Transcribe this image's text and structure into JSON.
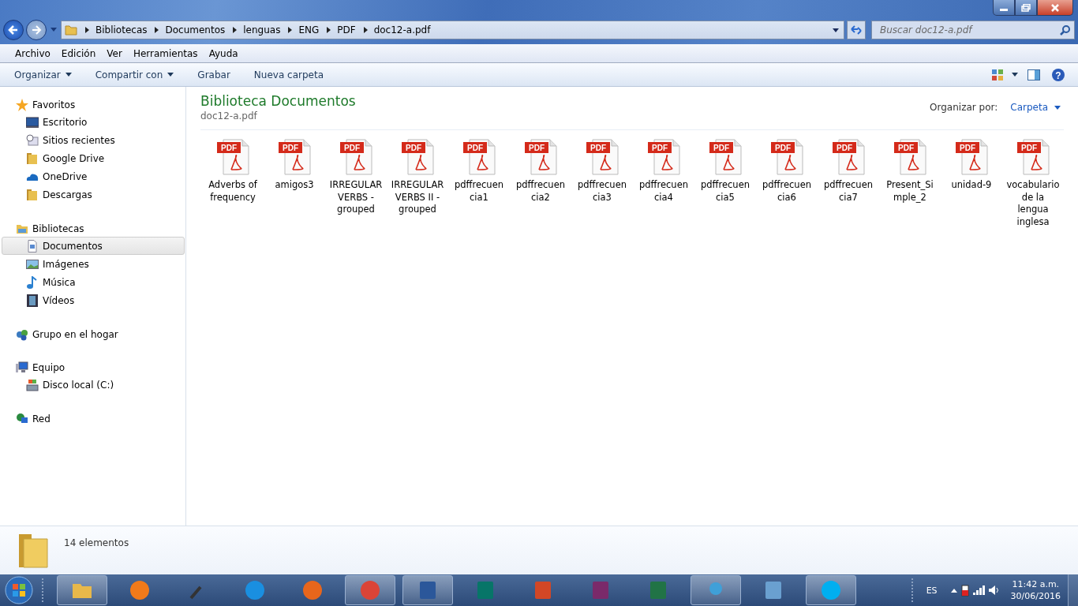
{
  "address": {
    "crumbs": [
      "Bibliotecas",
      "Documentos",
      "lenguas",
      "ENG",
      "PDF",
      "doc12-a.pdf"
    ]
  },
  "search": {
    "placeholder": "Buscar doc12-a.pdf"
  },
  "menu_bar": [
    "Archivo",
    "Edición",
    "Ver",
    "Herramientas",
    "Ayuda"
  ],
  "command_bar": [
    {
      "label": "Organizar",
      "dropdown": true
    },
    {
      "label": "Compartir con",
      "dropdown": true
    },
    {
      "label": "Grabar",
      "dropdown": false
    },
    {
      "label": "Nueva carpeta",
      "dropdown": false
    }
  ],
  "sidebar": {
    "groups": [
      {
        "label": "Favoritos",
        "kind": "star",
        "items": [
          {
            "label": "Escritorio",
            "kind": "desktop",
            "selected": false
          },
          {
            "label": "Sitios recientes",
            "kind": "recent",
            "selected": false
          },
          {
            "label": "Google Drive",
            "kind": "folder",
            "selected": false
          },
          {
            "label": "OneDrive",
            "kind": "cloud",
            "selected": false
          },
          {
            "label": "Descargas",
            "kind": "folder",
            "selected": false
          }
        ]
      },
      {
        "label": "Bibliotecas",
        "kind": "library",
        "items": [
          {
            "label": "Documentos",
            "kind": "document",
            "selected": true
          },
          {
            "label": "Imágenes",
            "kind": "picture",
            "selected": false
          },
          {
            "label": "Música",
            "kind": "music",
            "selected": false
          },
          {
            "label": "Vídeos",
            "kind": "video",
            "selected": false
          }
        ]
      },
      {
        "label": "Grupo en el hogar",
        "kind": "homegroup"
      },
      {
        "label": "Equipo",
        "kind": "computer",
        "items": [
          {
            "label": "Disco local (C:)",
            "kind": "drive",
            "selected": false
          }
        ]
      },
      {
        "label": "Red",
        "kind": "network"
      }
    ]
  },
  "help_glyph": "?",
  "content": {
    "title": "Biblioteca Documentos",
    "subtitle": "doc12-a.pdf",
    "arrange_label": "Organizar por:",
    "arrange_value": "Carpeta",
    "files": [
      {
        "badge": "PDF",
        "lines": [
          "Adverbs of",
          "frequency"
        ]
      },
      {
        "badge": "PDF",
        "lines": [
          "amigos3"
        ]
      },
      {
        "badge": "PDF",
        "lines": [
          "IRREGULAR",
          "VERBS -",
          "grouped"
        ]
      },
      {
        "badge": "PDF",
        "lines": [
          "IRREGULAR",
          "VERBS II -",
          "grouped"
        ]
      },
      {
        "badge": "PDF",
        "lines": [
          "pdffrecuen",
          "cia1"
        ]
      },
      {
        "badge": "PDF",
        "lines": [
          "pdffrecuen",
          "cia2"
        ]
      },
      {
        "badge": "PDF",
        "lines": [
          "pdffrecuen",
          "cia3"
        ]
      },
      {
        "badge": "PDF",
        "lines": [
          "pdffrecuen",
          "cia4"
        ]
      },
      {
        "badge": "PDF",
        "lines": [
          "pdffrecuen",
          "cia5"
        ]
      },
      {
        "badge": "PDF",
        "lines": [
          "pdffrecuen",
          "cia6"
        ]
      },
      {
        "badge": "PDF",
        "lines": [
          "pdffrecuen",
          "cia7"
        ]
      },
      {
        "badge": "PDF",
        "lines": [
          "Present_Si",
          "mple_2"
        ]
      },
      {
        "badge": "PDF",
        "lines": [
          "unidad-9"
        ]
      },
      {
        "badge": "PDF",
        "lines": [
          "vocabulario",
          "de la",
          "lengua",
          "inglesa"
        ]
      }
    ]
  },
  "status_bar": {
    "count": "14 elementos"
  },
  "taskbar": {
    "apps": [
      {
        "kind": "explorer",
        "open": true
      },
      {
        "kind": "media",
        "open": false
      },
      {
        "kind": "mic",
        "open": false
      },
      {
        "kind": "ie",
        "open": false
      },
      {
        "kind": "firefox",
        "open": false
      },
      {
        "kind": "chrome",
        "open": true
      },
      {
        "kind": "word",
        "open": true
      },
      {
        "kind": "publisher",
        "open": false
      },
      {
        "kind": "powerpoint",
        "open": false
      },
      {
        "kind": "winrar",
        "open": false
      },
      {
        "kind": "excel",
        "open": false
      },
      {
        "kind": "messenger",
        "open": true
      },
      {
        "kind": "calculator",
        "open": false
      },
      {
        "kind": "skype",
        "open": true
      }
    ],
    "language": "ES",
    "time": "11:42 a.m.",
    "date": "30/06/2016"
  }
}
